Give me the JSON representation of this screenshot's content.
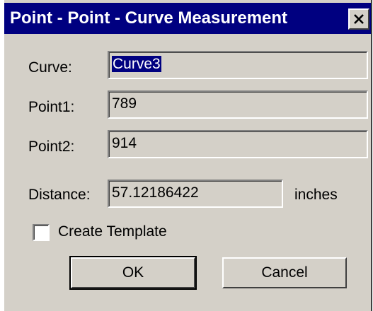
{
  "window": {
    "title": "Point - Point - Curve Measurement",
    "close_icon": "close-icon"
  },
  "fields": {
    "curve": {
      "label": "Curve:",
      "value": "Curve3"
    },
    "point1": {
      "label": "Point1:",
      "value": "789"
    },
    "point2": {
      "label": "Point2:",
      "value": "914"
    },
    "distance": {
      "label": "Distance:",
      "value": "57.12186422",
      "unit": "inches"
    }
  },
  "create_template": {
    "label": "Create Template",
    "checked": false
  },
  "buttons": {
    "ok": "OK",
    "cancel": "Cancel"
  },
  "colors": {
    "titlebar": "#000080",
    "dialog_bg": "#d4d0c8",
    "selection": "#000080"
  }
}
